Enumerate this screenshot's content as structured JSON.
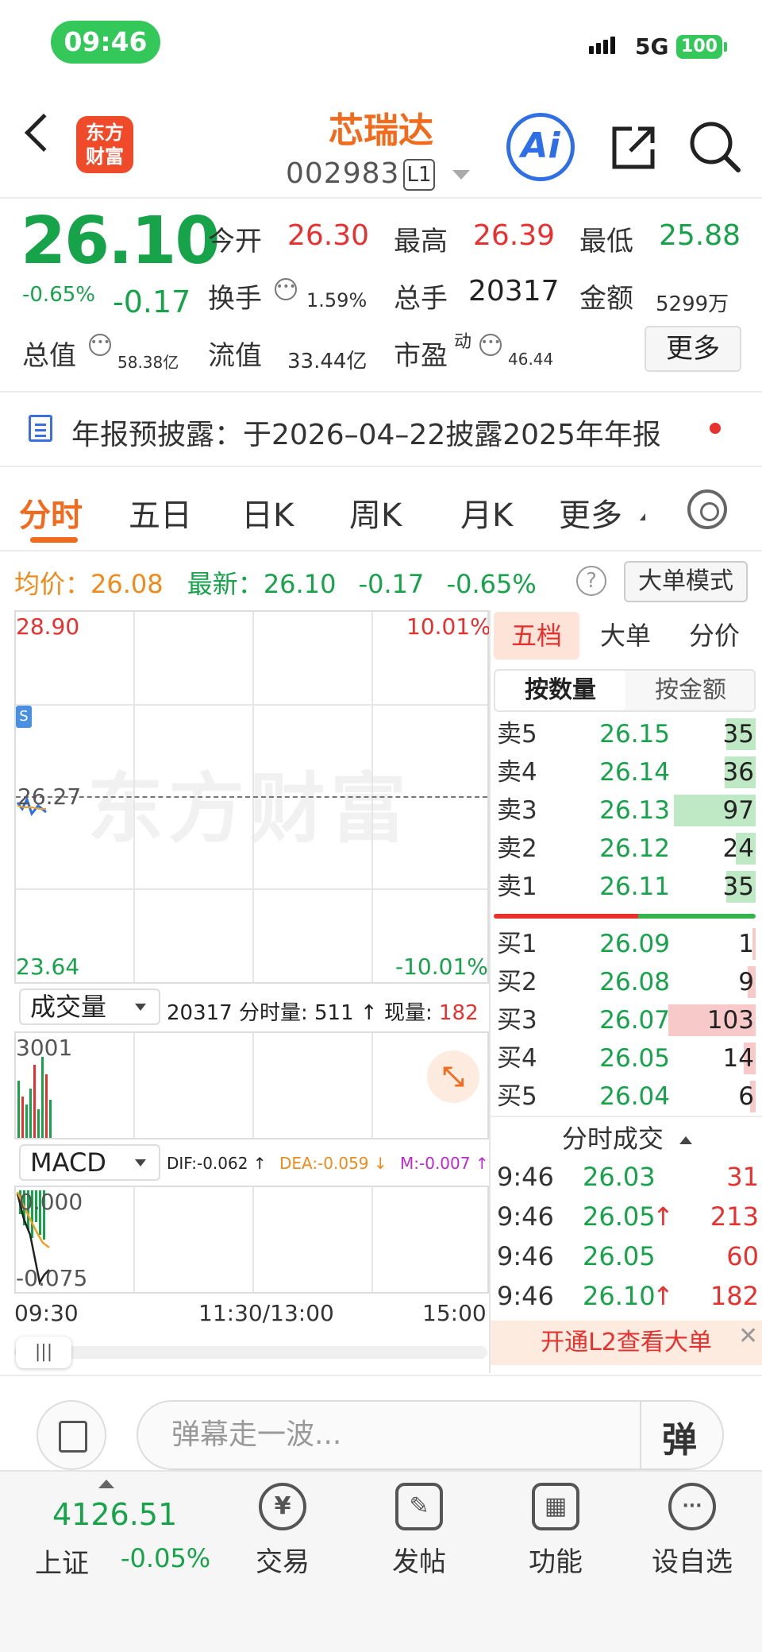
{
  "status_bar": {
    "time": "09:46",
    "network": "5G",
    "battery": "100"
  },
  "header": {
    "logo_line1": "东方",
    "logo_line2": "财富",
    "stock_name": "芯瑞达",
    "stock_code": "002983",
    "level": "L1",
    "ai_label": "Ai"
  },
  "quote": {
    "price": "26.10",
    "change_pct": "-0.65%",
    "change": "-0.17",
    "open_label": "今开",
    "open": "26.30",
    "high_label": "最高",
    "high": "26.39",
    "low_label": "最低",
    "low": "25.88",
    "turnover_label": "换手",
    "turnover": "1.59%",
    "volume_label": "总手",
    "volume": "20317",
    "amount_label": "金额",
    "amount": "5299万",
    "mkt_cap_label": "总值",
    "mkt_cap": "58.38亿",
    "float_cap_label": "流值",
    "float_cap": "33.44亿",
    "pe_label": "市盈",
    "pe_sup": "动",
    "pe": "46.44",
    "more_label": "更多"
  },
  "notice": {
    "text": "年报预披露：于2026–04–22披露2025年年报"
  },
  "tabs": [
    {
      "label": "分时",
      "active": true
    },
    {
      "label": "五日"
    },
    {
      "label": "日K"
    },
    {
      "label": "周K"
    },
    {
      "label": "月K"
    },
    {
      "label": "更多"
    }
  ],
  "avg_line": {
    "avg_label": "均价：",
    "avg": "26.08",
    "latest_label": "最新：",
    "latest": "26.10",
    "change": "-0.17",
    "change_pct": "-0.65%",
    "help": "?",
    "big_mode": "大单模式"
  },
  "chart": {
    "top_price": "28.90",
    "top_pct": "10.01%",
    "mid_price": "26.27",
    "bottom_price": "23.64",
    "bottom_pct": "-10.01%",
    "watermark": "东方财富"
  },
  "volume": {
    "selector": "成交量",
    "total": "20317",
    "tick_label": "分时量:",
    "tick": "511",
    "now_label": "现量:",
    "now": "182",
    "axis_max": "3001"
  },
  "macd": {
    "selector": "MACD",
    "dif": "DIF:-0.062",
    "dea": "DEA:-0.059",
    "m": "M:-0.007",
    "axis_top": "0.000",
    "axis_bottom": "-0.075"
  },
  "time_axis": [
    "09:30",
    "11:30/13:00",
    "15:00"
  ],
  "order_book": {
    "tabs": [
      "五档",
      "大单",
      "分价"
    ],
    "modes": [
      "按数量",
      "按金额"
    ],
    "asks": [
      {
        "label": "卖5",
        "price": "26.15",
        "qty": "35",
        "ratio": 0.34
      },
      {
        "label": "卖4",
        "price": "26.14",
        "qty": "36",
        "ratio": 0.35
      },
      {
        "label": "卖3",
        "price": "26.13",
        "qty": "97",
        "ratio": 0.94
      },
      {
        "label": "卖2",
        "price": "26.12",
        "qty": "24",
        "ratio": 0.23
      },
      {
        "label": "卖1",
        "price": "26.11",
        "qty": "35",
        "ratio": 0.34
      }
    ],
    "bids": [
      {
        "label": "买1",
        "price": "26.09",
        "qty": "1",
        "ratio": 0.02
      },
      {
        "label": "买2",
        "price": "26.08",
        "qty": "9",
        "ratio": 0.09
      },
      {
        "label": "买3",
        "price": "26.07",
        "qty": "103",
        "ratio": 1.0
      },
      {
        "label": "买4",
        "price": "26.05",
        "qty": "14",
        "ratio": 0.14
      },
      {
        "label": "买5",
        "price": "26.04",
        "qty": "6",
        "ratio": 0.06
      }
    ],
    "sell_ratio": 0.55
  },
  "trades": {
    "header": "分时成交",
    "rows": [
      {
        "time": "9:46",
        "price": "26.03",
        "qty": "31",
        "up": false
      },
      {
        "time": "9:46",
        "price": "26.05",
        "qty": "213",
        "up": true
      },
      {
        "time": "9:46",
        "price": "26.05",
        "qty": "60",
        "up": false
      },
      {
        "time": "9:46",
        "price": "26.10",
        "qty": "182",
        "up": true
      }
    ],
    "l2_banner": "开通L2查看大单"
  },
  "comment": {
    "placeholder": "弹幕走一波...",
    "danmu": "弹"
  },
  "bottom_nav": {
    "index_value": "4126.51",
    "index_name": "上证",
    "index_change": "-0.05%",
    "items": [
      {
        "label": "交易",
        "icon": "¥"
      },
      {
        "label": "发帖",
        "icon": "✎"
      },
      {
        "label": "功能",
        "icon": "▦"
      },
      {
        "label": "设自选",
        "icon": "···"
      }
    ]
  },
  "colors": {
    "up": "#e8312f",
    "down": "#16a34a",
    "accent": "#f26a1b"
  }
}
